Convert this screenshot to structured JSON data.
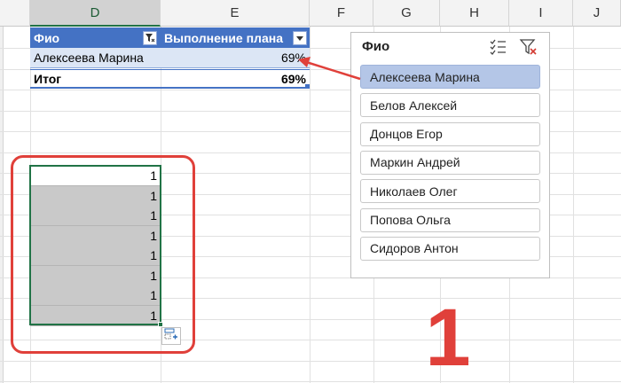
{
  "columns": [
    "D",
    "E",
    "F",
    "G",
    "H",
    "I",
    "J"
  ],
  "pivot": {
    "header_name": "Фио",
    "header_value": "Выполнение плана",
    "rows": [
      {
        "name": "Алексеева Марина",
        "value": "69%"
      }
    ],
    "total_label": "Итог",
    "total_value": "69%"
  },
  "slicer": {
    "title": "Фио",
    "multiselect_icon": "multiselect-icon",
    "clear_filter_icon": "clear-filter-icon",
    "items": [
      {
        "label": "Алексеева Марина",
        "selected": true
      },
      {
        "label": "Белов Алексей",
        "selected": false
      },
      {
        "label": "Донцов Егор",
        "selected": false
      },
      {
        "label": "Маркин Андрей",
        "selected": false
      },
      {
        "label": "Николаев Олег",
        "selected": false
      },
      {
        "label": "Попова Ольга",
        "selected": false
      },
      {
        "label": "Сидоров Антон",
        "selected": false
      }
    ]
  },
  "cells": [
    "1",
    "1",
    "1",
    "1",
    "1",
    "1",
    "1",
    "1"
  ],
  "annotation_number": "1",
  "colors": {
    "accent_red": "#e0403a",
    "pivot_header": "#4472c4",
    "slicer_selected": "#b4c6e7",
    "selection_green": "#217346"
  }
}
